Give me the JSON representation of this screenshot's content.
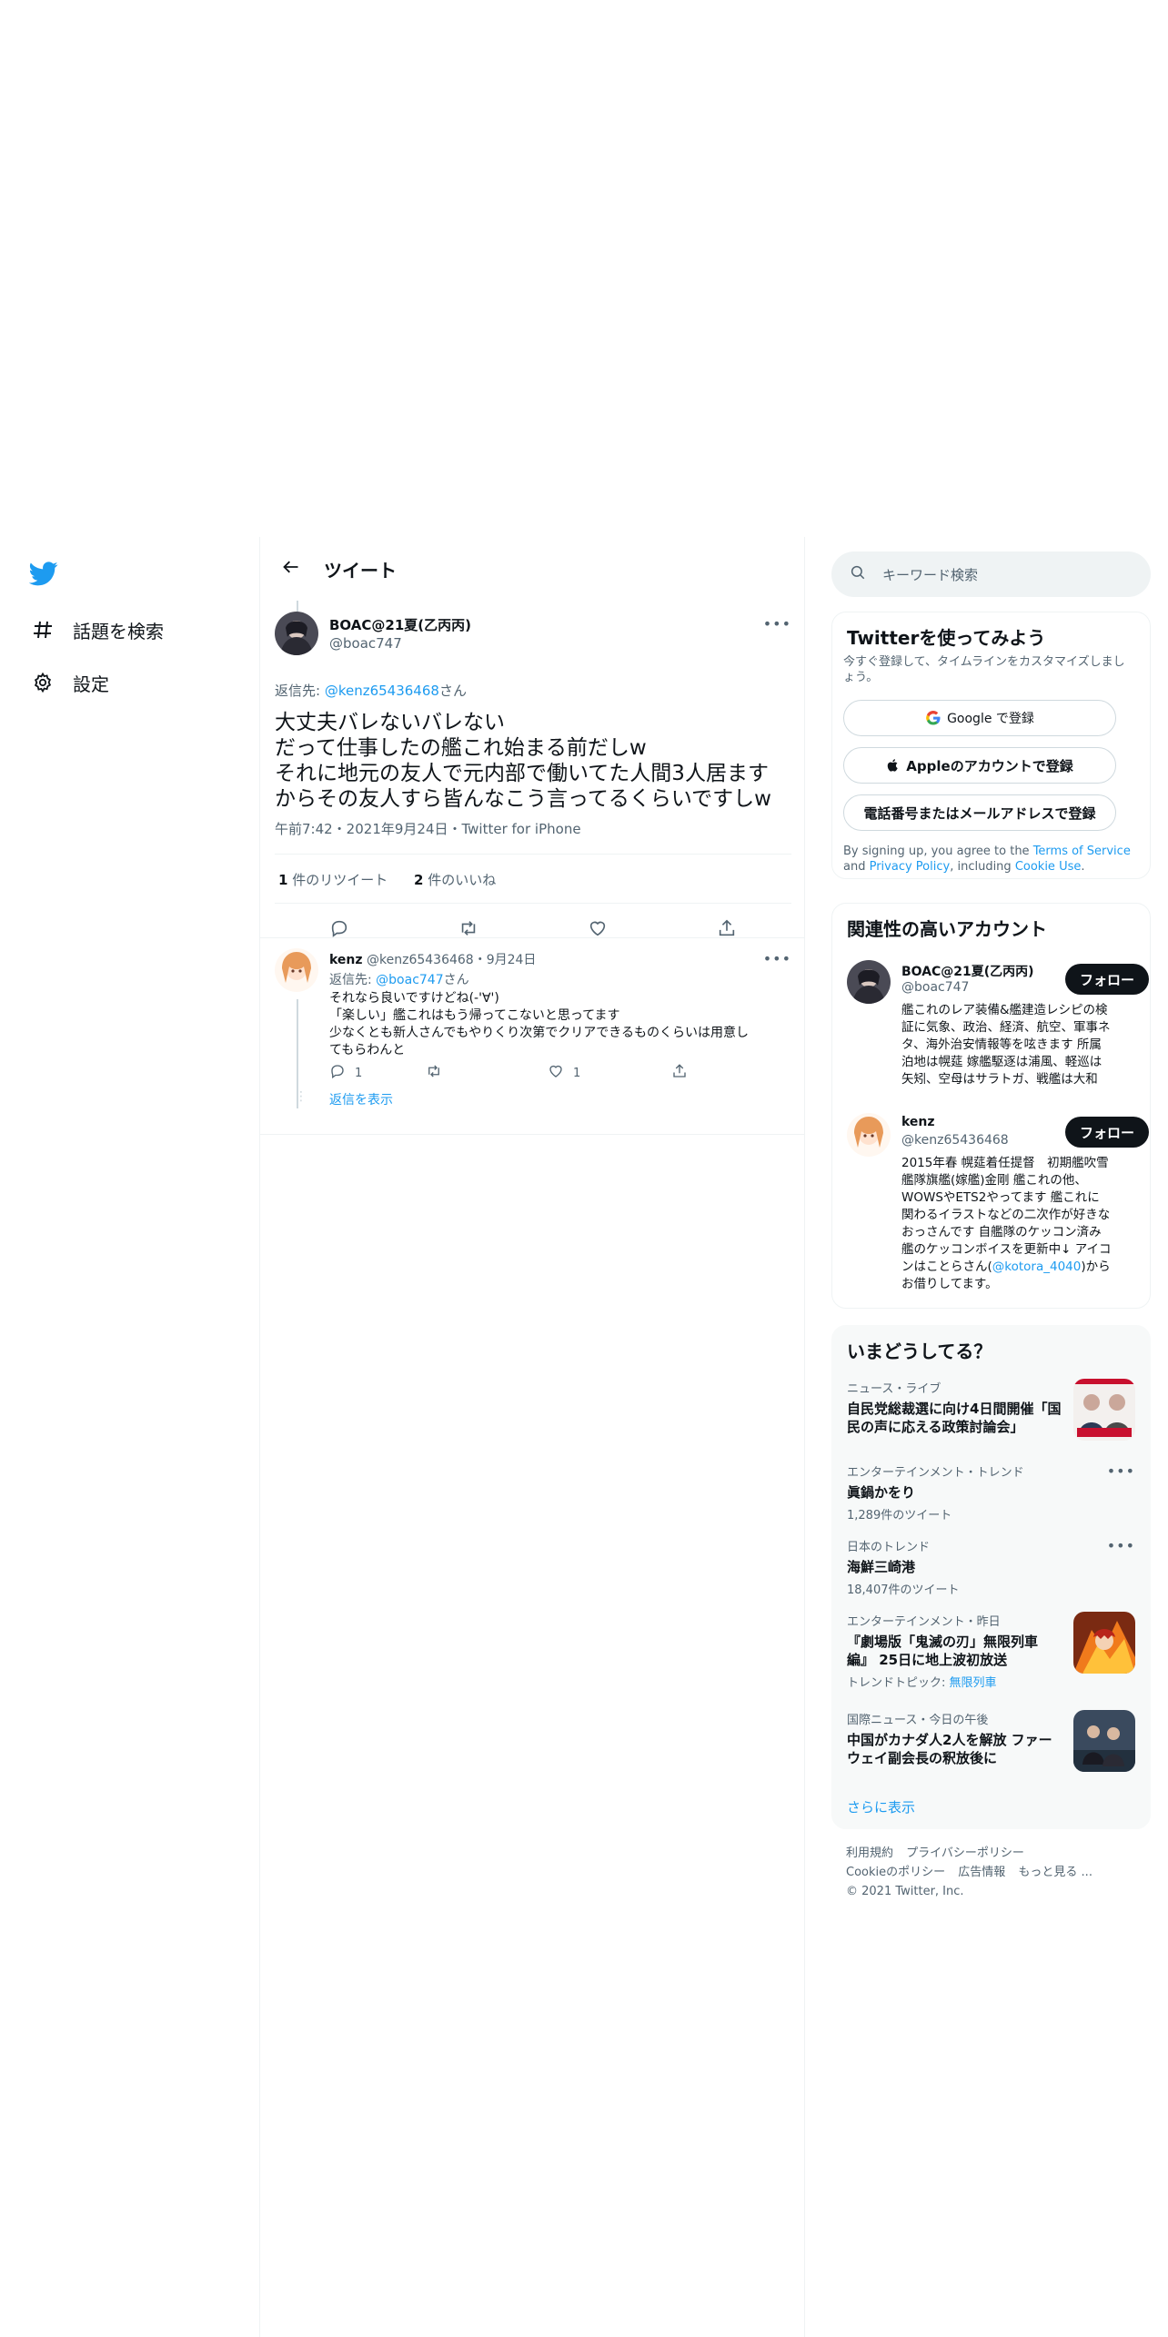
{
  "nav": {
    "explore_label": "話題を検索",
    "settings_label": "設定",
    "icons": [
      "twitter-logo",
      "hashtag-icon",
      "gear-icon"
    ]
  },
  "header": {
    "title": "ツイート"
  },
  "tweet": {
    "author_name": "BOAC@21夏(乙丙丙)",
    "author_handle": "@boac747",
    "reply_prefix": "返信先: ",
    "reply_to": "@kenz65436468",
    "reply_suffix": "さん",
    "text_lines": [
      "大丈夫バレないバレない",
      "だって仕事したの艦これ始まる前だしw",
      "それに地元の友人で元内部で働いてた人間3人居ます",
      "からその友人すら皆んなこう言ってるくらいですしw"
    ],
    "timestamp": "午前7:42・2021年9月24日・Twitter for iPhone",
    "retweet_count": "1",
    "retweet_label": " 件のリツイート",
    "like_count": "2",
    "like_label": " 件のいいね"
  },
  "reply": {
    "author_name": "kenz",
    "author_handle": "@kenz65436468",
    "date": "・9月24日",
    "reply_prefix": "返信先: ",
    "reply_to": "@boac747",
    "reply_suffix": "さん",
    "text_lines": [
      "それなら良いですけどね(-'∀')",
      "「楽しい」艦これはもう帰ってこないと思ってます",
      "少なくとも新人さんでもやりくり次第でクリアできるものくらいは用意し",
      "てもらわんと"
    ],
    "reply_count": "1",
    "like_count": "1",
    "show_replies": "返信を表示"
  },
  "search": {
    "placeholder": "キーワード検索"
  },
  "signup": {
    "title": "Twitterを使ってみよう",
    "subtitle": "今すぐ登録して、タイムラインをカスタマイズしましょう。",
    "google": "Google で登録",
    "apple": "Appleのアカウントで登録",
    "phone": "電話番号またはメールアドレスで登録",
    "terms_1": "By signing up, you agree to the ",
    "terms_link": "Terms of Service",
    "terms_2": " and ",
    "privacy_link": "Privacy Policy",
    "terms_3": ", including ",
    "cookie_link": "Cookie Use",
    "terms_4": "."
  },
  "relevant": {
    "title": "関連性の高いアカウント",
    "follow_label": "フォロー",
    "accounts": [
      {
        "name": "BOAC@21夏(乙丙丙)",
        "handle": "@boac747",
        "bio_lines": [
          "艦これのレア装備&艦建造レシピの検",
          "証に気象、政治、経済、航空、軍事ネ",
          "タ、海外治安情報等を呟きます 所属",
          "泊地は幌莚 嫁艦駆逐は浦風、軽巡は",
          "矢矧、空母はサラトガ、戦艦は大和"
        ]
      },
      {
        "name": "kenz",
        "handle": "@kenz65436468",
        "bio_lines": [
          "2015年春 幌莚着任提督　初期艦吹雪",
          "艦隊旗艦(嫁艦)金剛 艦これの他、",
          "WOWSやETS2やってます 艦これに",
          "関わるイラストなどの二次作が好きな",
          "おっさんです 自艦隊のケッコン済み",
          "艦のケッコンボイスを更新中↓ アイコ"
        ],
        "bio_last_pre": "ンはことらさん(",
        "bio_last_link": "@kotora_4040",
        "bio_last_post": ")から",
        "bio_end": "お借りしてます。"
      }
    ]
  },
  "trends": {
    "title": "いまどうしてる？",
    "items": [
      {
        "meta": "ニュース・ライブ",
        "name_lines": [
          "自民党総裁選に向け4日間開催「国",
          "民の声に応える政策討論会」"
        ]
      },
      {
        "meta": "エンターテインメント・トレンド",
        "name": "眞鍋かをり",
        "count": "1,289件のツイート"
      },
      {
        "meta": "日本のトレンド",
        "name": "海鮮三崎港",
        "count": "18,407件のツイート"
      },
      {
        "meta": "エンターテインメント・昨日",
        "name_lines": [
          "『劇場版「鬼滅の刃」無限列車",
          "編』 25日に地上波初放送"
        ],
        "topic_prefix": "トレンドトピック: ",
        "topic": "無限列車"
      },
      {
        "meta": "国際ニュース・今日の午後",
        "name_lines": [
          "中国がカナダ人2人を解放 ファー",
          "ウェイ副会長の釈放後に"
        ]
      }
    ],
    "show_more": "さらに表示"
  },
  "footer": {
    "line1": [
      "利用規約",
      "プライバシーポリシー"
    ],
    "line2": [
      "Cookieのポリシー",
      "広告情報",
      "もっと見る ..."
    ],
    "copyright": "© 2021 Twitter, Inc."
  },
  "colors": {
    "accent": "#1d9bf0",
    "text": "#0f1419",
    "muted": "#536471",
    "border": "#eff3f4"
  }
}
